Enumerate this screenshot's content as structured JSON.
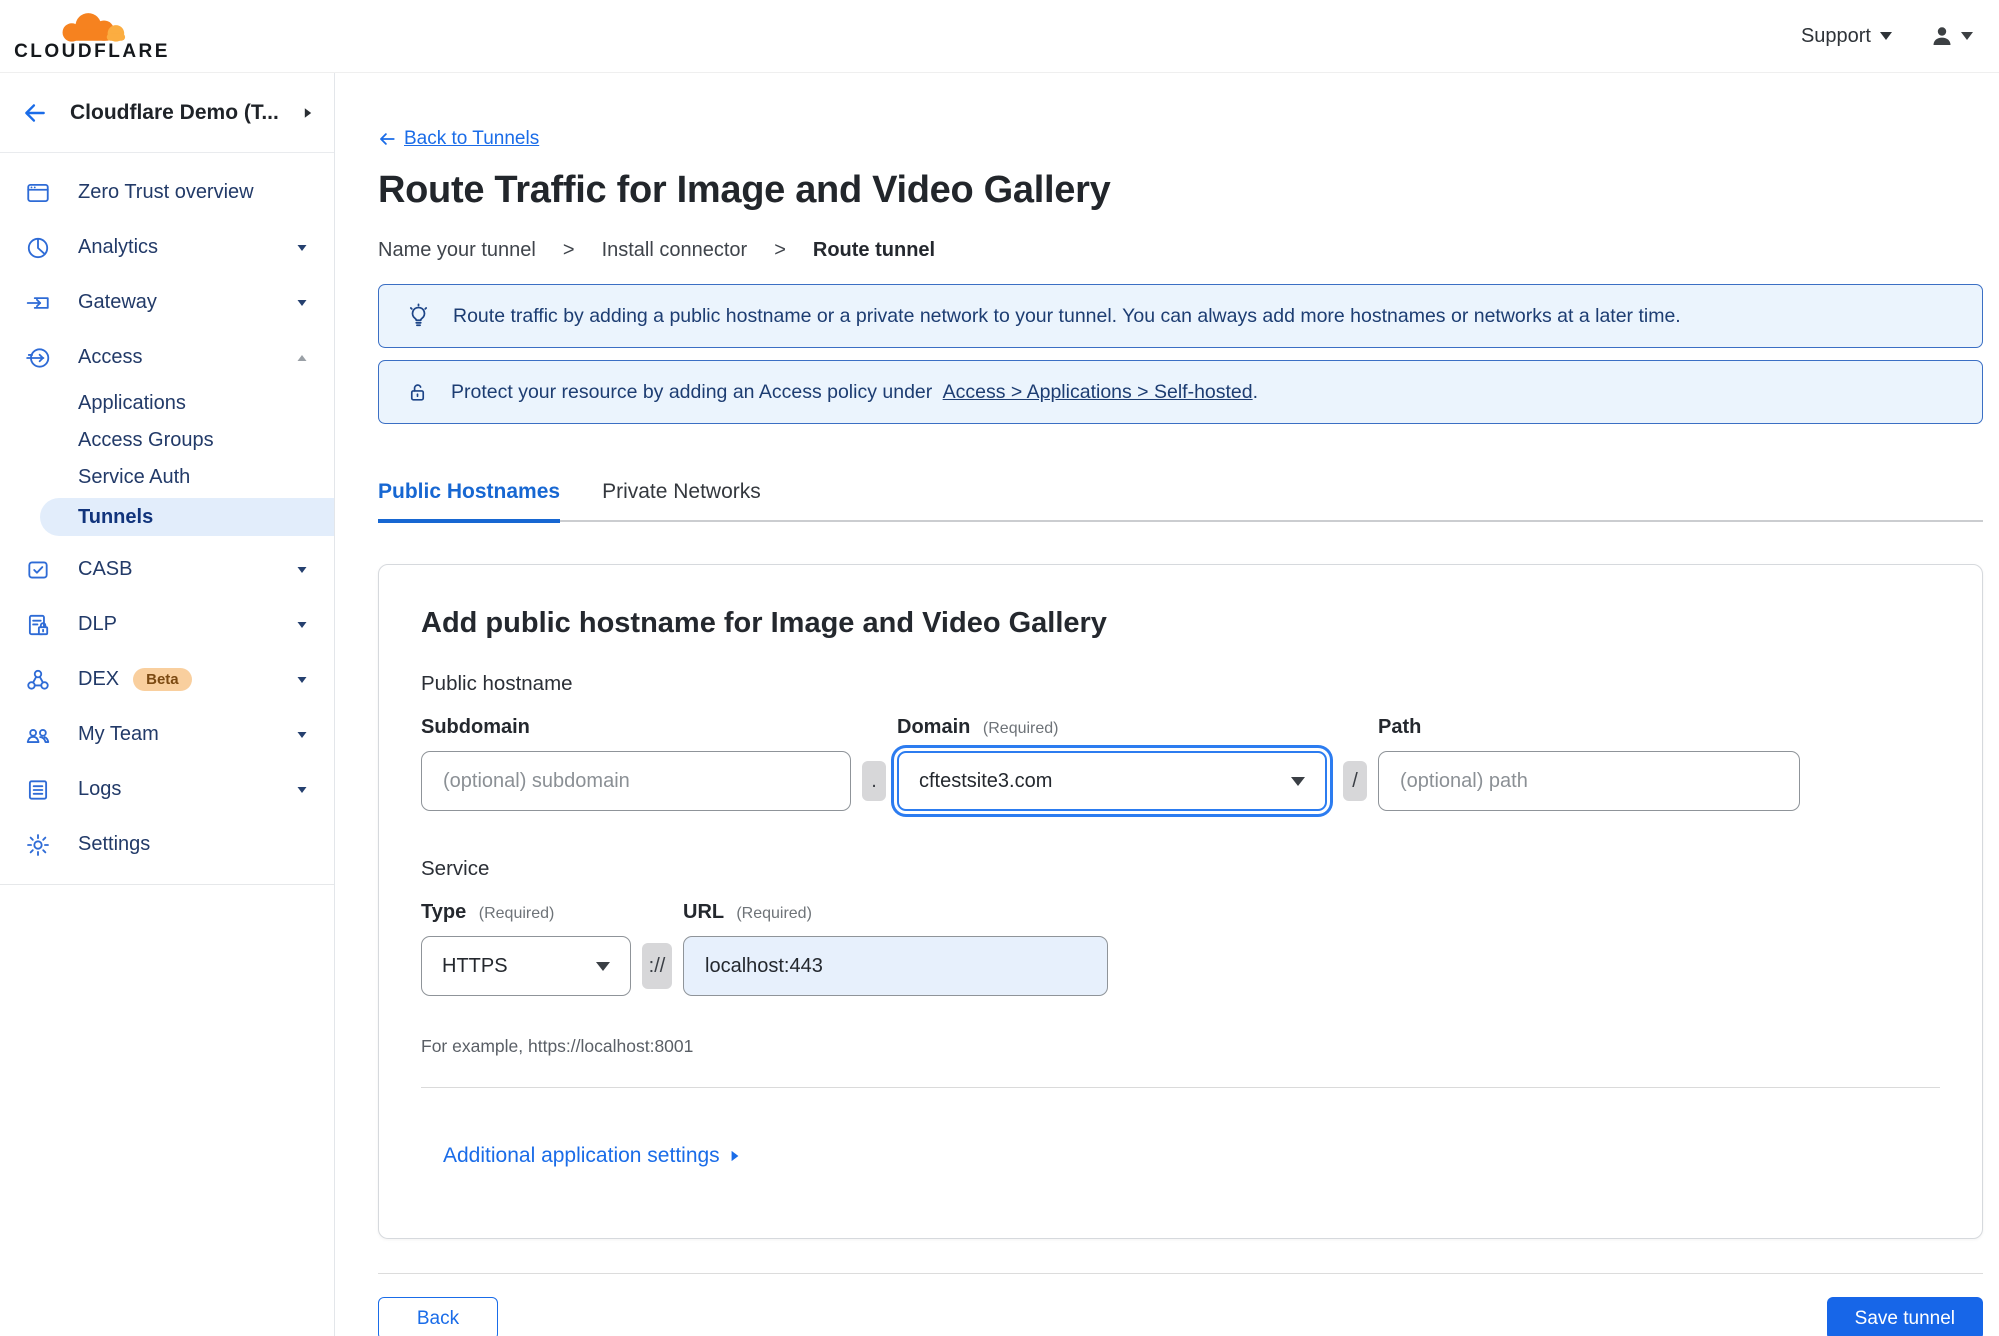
{
  "brand": {
    "name": "CLOUDFLARE"
  },
  "topbar": {
    "support": "Support"
  },
  "sidebar": {
    "account": "Cloudflare Demo (T...",
    "items": [
      {
        "label": "Zero Trust overview"
      },
      {
        "label": "Analytics"
      },
      {
        "label": "Gateway"
      },
      {
        "label": "Access"
      },
      {
        "label": "CASB"
      },
      {
        "label": "DLP"
      },
      {
        "label": "DEX",
        "badge": "Beta"
      },
      {
        "label": "My Team"
      },
      {
        "label": "Logs"
      },
      {
        "label": "Settings"
      }
    ],
    "access_children": [
      {
        "label": "Applications"
      },
      {
        "label": "Access Groups"
      },
      {
        "label": "Service Auth"
      },
      {
        "label": "Tunnels"
      }
    ]
  },
  "page": {
    "back_link": "Back to Tunnels",
    "title": "Route Traffic for Image and Video Gallery",
    "steps": [
      "Name your tunnel",
      "Install connector",
      "Route tunnel"
    ],
    "step_separator": ">",
    "banners": {
      "info": "Route traffic by adding a public hostname or a private network to your tunnel. You can always add more hostnames or networks at a later time.",
      "protect_prefix": "Protect your resource by adding an Access policy under",
      "protect_link": "Access > Applications > Self-hosted",
      "protect_suffix": "."
    },
    "tabs": [
      {
        "label": "Public Hostnames"
      },
      {
        "label": "Private Networks"
      }
    ]
  },
  "form": {
    "heading": "Add public hostname for Image and Video Gallery",
    "public_hostname_label": "Public hostname",
    "required_hint": "(Required)",
    "subdomain": {
      "label": "Subdomain",
      "placeholder": "(optional) subdomain"
    },
    "domain": {
      "label": "Domain",
      "value": "cftestsite3.com"
    },
    "path": {
      "label": "Path",
      "placeholder": "(optional) path"
    },
    "separators": {
      "dot": ".",
      "slash": "/",
      "scheme": "://"
    },
    "service_label": "Service",
    "type": {
      "label": "Type",
      "value": "HTTPS"
    },
    "url": {
      "label": "URL",
      "value": "localhost:443"
    },
    "example": "For example, https://localhost:8001",
    "additional_settings": "Additional application settings"
  },
  "footer": {
    "back": "Back",
    "save": "Save tunnel"
  },
  "colors": {
    "accent": "#1a6ce8",
    "save_blue": "#1766e8",
    "banner_bg": "#ebf4fd",
    "banner_border": "#3b6fc4",
    "active_pill": "#e2edfb",
    "beta_badge": "#f9cf9e"
  }
}
